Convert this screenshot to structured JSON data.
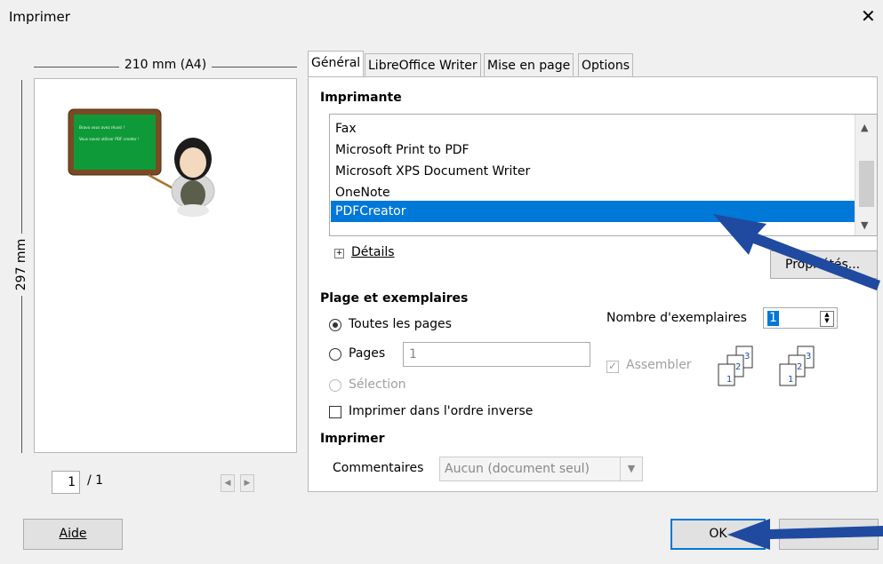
{
  "window": {
    "title": "Imprimer",
    "close_glyph": "✕"
  },
  "preview": {
    "width_label": "210 mm (A4)",
    "height_label": "297 mm",
    "page_current": "1",
    "page_total": "/ 1",
    "slide_line1": "Bravo vous avez réussi !",
    "slide_line2": "Vous savez utiliser PDF creator !"
  },
  "tabs": [
    {
      "label": "Général",
      "active": true
    },
    {
      "label": "LibreOffice Writer"
    },
    {
      "label": "Mise en page"
    },
    {
      "label": "Options"
    }
  ],
  "printer": {
    "heading": "Imprimante",
    "items": [
      "Fax",
      "Microsoft Print to PDF",
      "Microsoft XPS Document Writer",
      "OneNote",
      "PDFCreator"
    ],
    "selected": "PDFCreator",
    "details_label": "Détails",
    "properties_label": "Propriétés..."
  },
  "range": {
    "heading": "Plage et exemplaires",
    "all_pages": "Toutes les pages",
    "pages": "Pages",
    "pages_value": "1",
    "selection": "Sélection",
    "reverse": "Imprimer dans l'ordre inverse",
    "copies_label": "Nombre d'exemplaires",
    "copies_value": "1",
    "collate": "Assembler"
  },
  "print": {
    "heading": "Imprimer",
    "comments_label": "Commentaires",
    "comments_value": "Aucun (document seul)"
  },
  "buttons": {
    "help": "Aide",
    "ok": "OK",
    "cancel": "Annuler"
  },
  "colors": {
    "selection": "#0078d7",
    "arrow": "#1f4aa0",
    "chalkboard": "#0f9a3a",
    "frame": "#7a4a22"
  }
}
